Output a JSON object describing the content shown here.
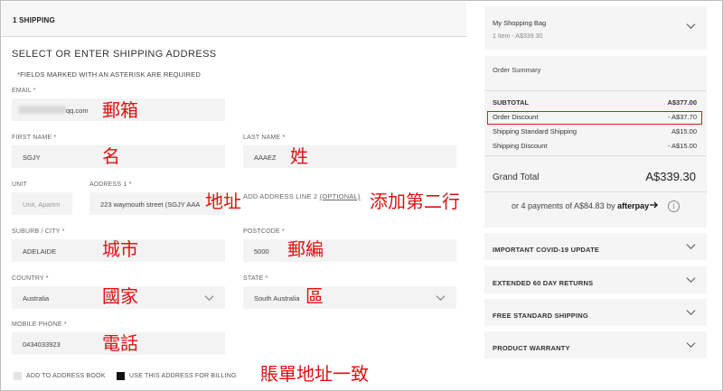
{
  "checkout": {
    "step_label": "1 SHIPPING",
    "section_title": "SELECT OR ENTER SHIPPING ADDRESS",
    "required_note": "*FIELDS MARKED WITH AN ASTERISK ARE REQUIRED"
  },
  "form": {
    "email": {
      "label": "EMAIL *",
      "value": "qq.com"
    },
    "first_name": {
      "label": "FIRST NAME *",
      "value": "SGJY"
    },
    "last_name": {
      "label": "LAST NAME *",
      "value": "AAAEZ"
    },
    "unit": {
      "label": "UNIT",
      "placeholder": "Unit, Apartm"
    },
    "address1": {
      "label": "ADDRESS 1 *",
      "value": "223 waymouth street (SGJY AAA"
    },
    "address2": {
      "label": "ADD ADDRESS LINE 2",
      "optional": "(OPTIONAL)"
    },
    "suburb": {
      "label": "SUBURB / CITY *",
      "value": "ADELAIDE"
    },
    "postcode": {
      "label": "POSTCODE *",
      "value": "5000"
    },
    "country": {
      "label": "COUNTRY *",
      "value": "Australia"
    },
    "state": {
      "label": "STATE *",
      "value": "South Australia"
    },
    "mobile": {
      "label": "MOBILE PHONE *",
      "value": "0434033923"
    },
    "add_to_book": "ADD TO ADDRESS BOOK",
    "use_for_billing": "USE THIS ADDRESS FOR BILLING"
  },
  "annotations": {
    "email": "郵箱",
    "first_name": "名",
    "last_name": "姓",
    "address": "地址",
    "add_line2": "添加第二行",
    "city": "城市",
    "postcode": "郵編",
    "country": "國家",
    "state": "區",
    "phone": "電話",
    "billing": "賬單地址一致"
  },
  "bag": {
    "title": "My Shopping Bag",
    "subtitle": "1 Item - A$339.30"
  },
  "summary": {
    "title": "Order Summary",
    "rows": [
      {
        "label": "SUBTOTAL",
        "value": "A$377.00"
      },
      {
        "label": "Order Discount",
        "value": "- A$37.70"
      },
      {
        "label": "Shipping Standard Shipping",
        "value": "A$15.00"
      },
      {
        "label": "Shipping Discount",
        "value": "- A$15.00"
      }
    ],
    "grand_total_label": "Grand Total",
    "grand_total_value": "A$339.30",
    "afterpay_text": "or 4 payments of A$84.83 by",
    "afterpay_brand": "afterpay",
    "info_glyph": "i"
  },
  "accordions": [
    {
      "label": "IMPORTANT COVID-19 UPDATE"
    },
    {
      "label": "EXTENDED 60 DAY RETURNS"
    },
    {
      "label": "FREE STANDARD SHIPPING"
    },
    {
      "label": "PRODUCT WARRANTY"
    }
  ],
  "colors": {
    "annotation": "#e01010",
    "highlight_border": "#d0211c",
    "field_bg": "#f3f3f3",
    "panel_bg": "#f5f5f5"
  },
  "icons": [
    "chevron-down-icon",
    "info-icon"
  ]
}
